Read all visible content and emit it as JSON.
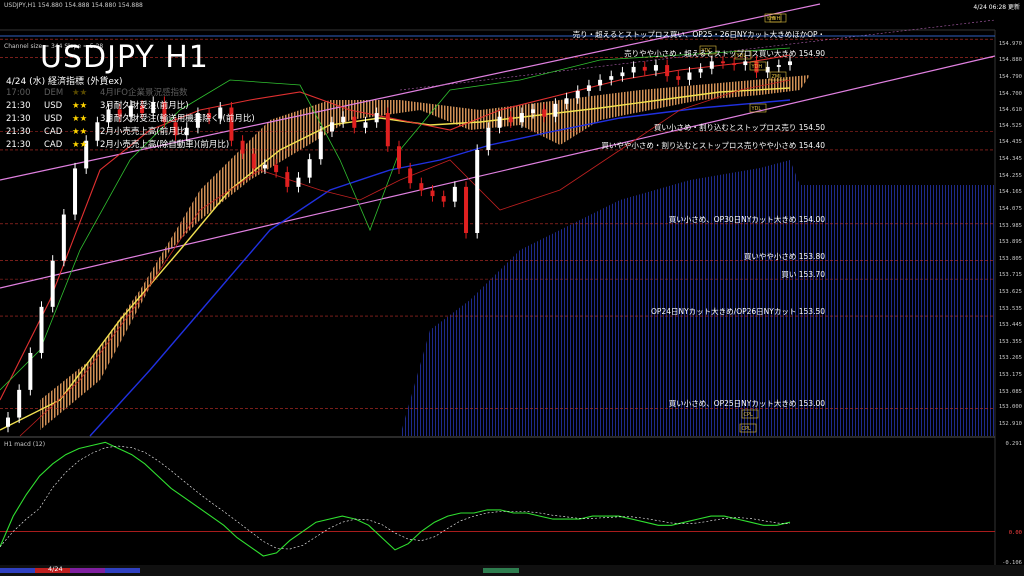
{
  "header": {
    "window_title": "USDJPY,H1  154.880 154.888 154.880 154.888",
    "datetime": "4/24 06:28 更新",
    "channel_info": "Channel size = 344 Slope = 5.28"
  },
  "title": "USDJPY H1",
  "subtitle": "4/24 (水) 経済指標 (外貨ex)",
  "events": [
    {
      "time": "17:00",
      "ccy": "DEM",
      "stars": "★★",
      "label": "4月IFO企業景況感指数",
      "dim": true
    },
    {
      "time": "21:30",
      "ccy": "USD",
      "stars": "★★",
      "label": "3月耐久財受注(前月比)",
      "dim": false
    },
    {
      "time": "21:30",
      "ccy": "USD",
      "stars": "★★",
      "label": "3月耐久財受注(輸送用機器除く)(前月比)",
      "dim": false
    },
    {
      "time": "21:30",
      "ccy": "CAD",
      "stars": "★★",
      "label": "2月小売売上高(前月比)",
      "dim": false
    },
    {
      "time": "21:30",
      "ccy": "CAD",
      "stars": "★★",
      "label": "2月小売売上高(除自動車)(前月比)",
      "dim": false
    }
  ],
  "orders": [
    {
      "text": "売り・超えるとストップロス買い、OP25・26日NYカット大きめほかOP・",
      "price": 155.0
    },
    {
      "text": "売りやや小さめ・超えるとストップロス買い大きめ 154.90",
      "price": 154.9
    },
    {
      "text": "買い小さめ・割り込むとストップロス売り 154.50",
      "price": 154.5
    },
    {
      "text": "買いやや小さめ・割り込むとストップロス売りやや小さめ 154.40",
      "price": 154.4
    },
    {
      "text": "買い小さめ、OP30日NYカット大きめ 154.00",
      "price": 154.0
    },
    {
      "text": "買いやや小さめ 153.80",
      "price": 153.8
    },
    {
      "text": "買い 153.70",
      "price": 153.7
    },
    {
      "text": "OP24日NYカット大きめ/OP26日NYカット 153.50",
      "price": 153.5
    },
    {
      "text": "買い小さめ、OP25日NYカット大きめ 153.00",
      "price": 153.0
    }
  ],
  "price_axis": [
    "154.970",
    "154.880",
    "154.790",
    "154.700",
    "154.610",
    "154.525",
    "154.435",
    "154.345",
    "154.255",
    "154.165",
    "154.075",
    "153.985",
    "153.895",
    "153.805",
    "153.715",
    "153.625",
    "153.535",
    "153.445",
    "153.355",
    "153.265",
    "153.175",
    "153.085",
    "153.000",
    "152.910"
  ],
  "level_tags": [
    "Y.Hi",
    "YDH",
    "YDC",
    "YDL",
    "YDL",
    "WHi",
    "ZML",
    "CPL",
    "CPL"
  ],
  "macd_panel": {
    "label": "H1  macd (12)",
    "axis": [
      "0.291",
      "0.00",
      "-0.106"
    ]
  },
  "bottom_date": "4/24",
  "chart_data": {
    "type": "candlestick",
    "symbol": "USDJPY",
    "timeframe": "H1",
    "ylim": [
      152.85,
      155.05
    ],
    "close": [
      152.95,
      153.1,
      153.3,
      153.55,
      153.8,
      154.05,
      154.3,
      154.45,
      154.55,
      154.62,
      154.58,
      154.64,
      154.6,
      154.66,
      154.55,
      154.48,
      154.52,
      154.6,
      154.57,
      154.63,
      154.45,
      154.38,
      154.3,
      154.32,
      154.28,
      154.2,
      154.25,
      154.35,
      154.5,
      154.55,
      154.58,
      154.52,
      154.55,
      154.6,
      154.42,
      154.3,
      154.22,
      154.18,
      154.15,
      154.12,
      154.2,
      153.95,
      154.4,
      154.52,
      154.58,
      154.55,
      154.6,
      154.62,
      154.58,
      154.65,
      154.68,
      154.72,
      154.75,
      154.78,
      154.8,
      154.82,
      154.85,
      154.83,
      154.86,
      154.8,
      154.78,
      154.82,
      154.84,
      154.88,
      154.87,
      154.86,
      154.88,
      154.82,
      154.85,
      154.86,
      154.88
    ],
    "macd": [
      -0.05,
      0.05,
      0.12,
      0.18,
      0.22,
      0.25,
      0.27,
      0.28,
      0.29,
      0.27,
      0.25,
      0.22,
      0.18,
      0.14,
      0.11,
      0.08,
      0.05,
      0.02,
      -0.02,
      -0.05,
      -0.08,
      -0.07,
      -0.03,
      0.0,
      0.03,
      0.04,
      0.05,
      0.04,
      0.02,
      -0.02,
      -0.06,
      -0.04,
      0.0,
      0.03,
      0.05,
      0.06,
      0.06,
      0.07,
      0.07,
      0.06,
      0.06,
      0.05,
      0.04,
      0.04,
      0.04,
      0.05,
      0.05,
      0.05,
      0.04,
      0.03,
      0.02,
      0.02,
      0.03,
      0.04,
      0.05,
      0.05,
      0.04,
      0.03,
      0.02,
      0.02,
      0.03
    ]
  }
}
